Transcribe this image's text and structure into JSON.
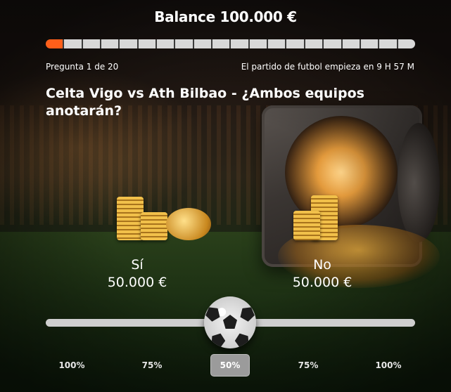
{
  "header": {
    "balance": "Balance 100.000 €"
  },
  "progress": {
    "current": 1,
    "total": 20,
    "accent_color": "#ff5f1a"
  },
  "meta": {
    "question_counter": "Pregunta 1 de 20",
    "countdown": "El partido de futbol empieza en 9 H 57 M"
  },
  "question": {
    "text": "Celta Vigo vs Ath Bilbao - ¿Ambos equipos anotarán?"
  },
  "options": {
    "yes": {
      "label": "Sí",
      "amount": "50.000 €"
    },
    "no": {
      "label": "No",
      "amount": "50.000 €"
    }
  },
  "slider": {
    "value_percent": 50,
    "thumb_icon": "soccer-ball-icon"
  },
  "percent_buttons": [
    {
      "label": "100%",
      "selected": false
    },
    {
      "label": "75%",
      "selected": false
    },
    {
      "label": "50%",
      "selected": true
    },
    {
      "label": "75%",
      "selected": false
    },
    {
      "label": "100%",
      "selected": false
    }
  ]
}
